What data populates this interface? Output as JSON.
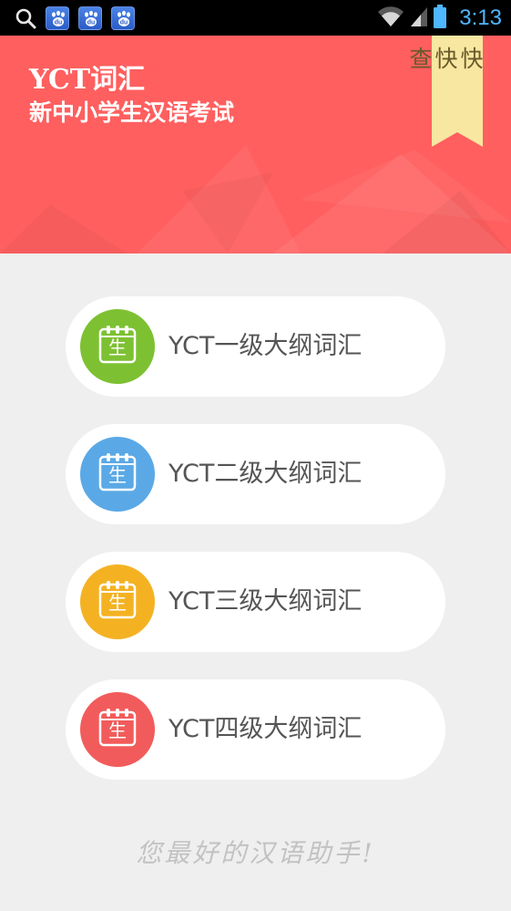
{
  "status_bar": {
    "time": "3:13",
    "icons": [
      "search-icon",
      "baidu-icon",
      "baidu-icon",
      "baidu-icon",
      "wifi-icon",
      "signal-icon",
      "battery-icon"
    ],
    "baidu_label": "du",
    "clock_color": "#4fb6ff"
  },
  "header": {
    "title": "YCT词汇",
    "subtitle": "新中小学生汉语考试",
    "ribbon": "快快查",
    "background_color": "#ff5f5f",
    "ribbon_color": "#f7e7a0"
  },
  "levels": [
    {
      "label": "YCT一级大纲词汇",
      "icon_char": "生",
      "icon": "calendar-icon",
      "color": "#7dc132"
    },
    {
      "label": "YCT二级大纲词汇",
      "icon_char": "生",
      "icon": "calendar-icon",
      "color": "#5aa9e6"
    },
    {
      "label": "YCT三级大纲词汇",
      "icon_char": "生",
      "icon": "calendar-icon",
      "color": "#f4b223"
    },
    {
      "label": "YCT四级大纲词汇",
      "icon_char": "生",
      "icon": "calendar-icon",
      "color": "#f25b5b"
    }
  ],
  "footer": {
    "slogan": "您最好的汉语助手!"
  }
}
